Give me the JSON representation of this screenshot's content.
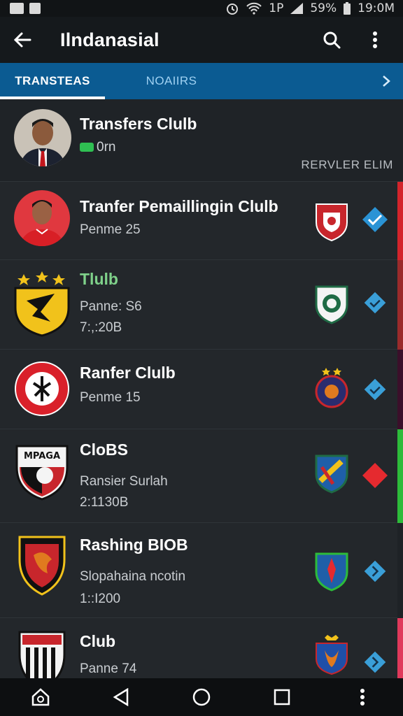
{
  "status": {
    "battery": "59%",
    "time": "19:0M",
    "signal": "1P"
  },
  "app": {
    "title": "Ilndanasial"
  },
  "tabs": [
    {
      "label": "TRANSTEAS"
    },
    {
      "label": "NOAIIRS"
    }
  ],
  "featured": {
    "title": "Transfers Clulb",
    "value": "0rn",
    "note": "RERVLER ELIM"
  },
  "items": [
    {
      "title": "Tranfer Pemaillingin Clulb",
      "line1": "Penme 25",
      "line2": "",
      "accent": "#d3242b"
    },
    {
      "title": "Tlulb",
      "line1": "Panne: S6",
      "line2": "7:,:20B",
      "accent": "#9a2b2b"
    },
    {
      "title": "Ranfer Clulb",
      "line1": "Penme 15",
      "line2": "",
      "accent": "#3b0f2a"
    },
    {
      "title": "CloBS",
      "line1": "Ransier Surlah",
      "line2": "2:1130B",
      "accent": "#2dbb3a"
    },
    {
      "title": "Rashing BIOB",
      "line1": "Slopahaina ncotin",
      "line2": "1::I200",
      "accent": "#1e2226"
    },
    {
      "title": "Club",
      "line1": "Panne 74",
      "line2": "",
      "accent": "#e0395b"
    }
  ],
  "colors": {
    "tab_bar": "#0b5b92",
    "app_bar": "#15191c",
    "list_bg": "#23272b",
    "check_blue": "#2a93d5",
    "check_red": "#e52a2f"
  }
}
